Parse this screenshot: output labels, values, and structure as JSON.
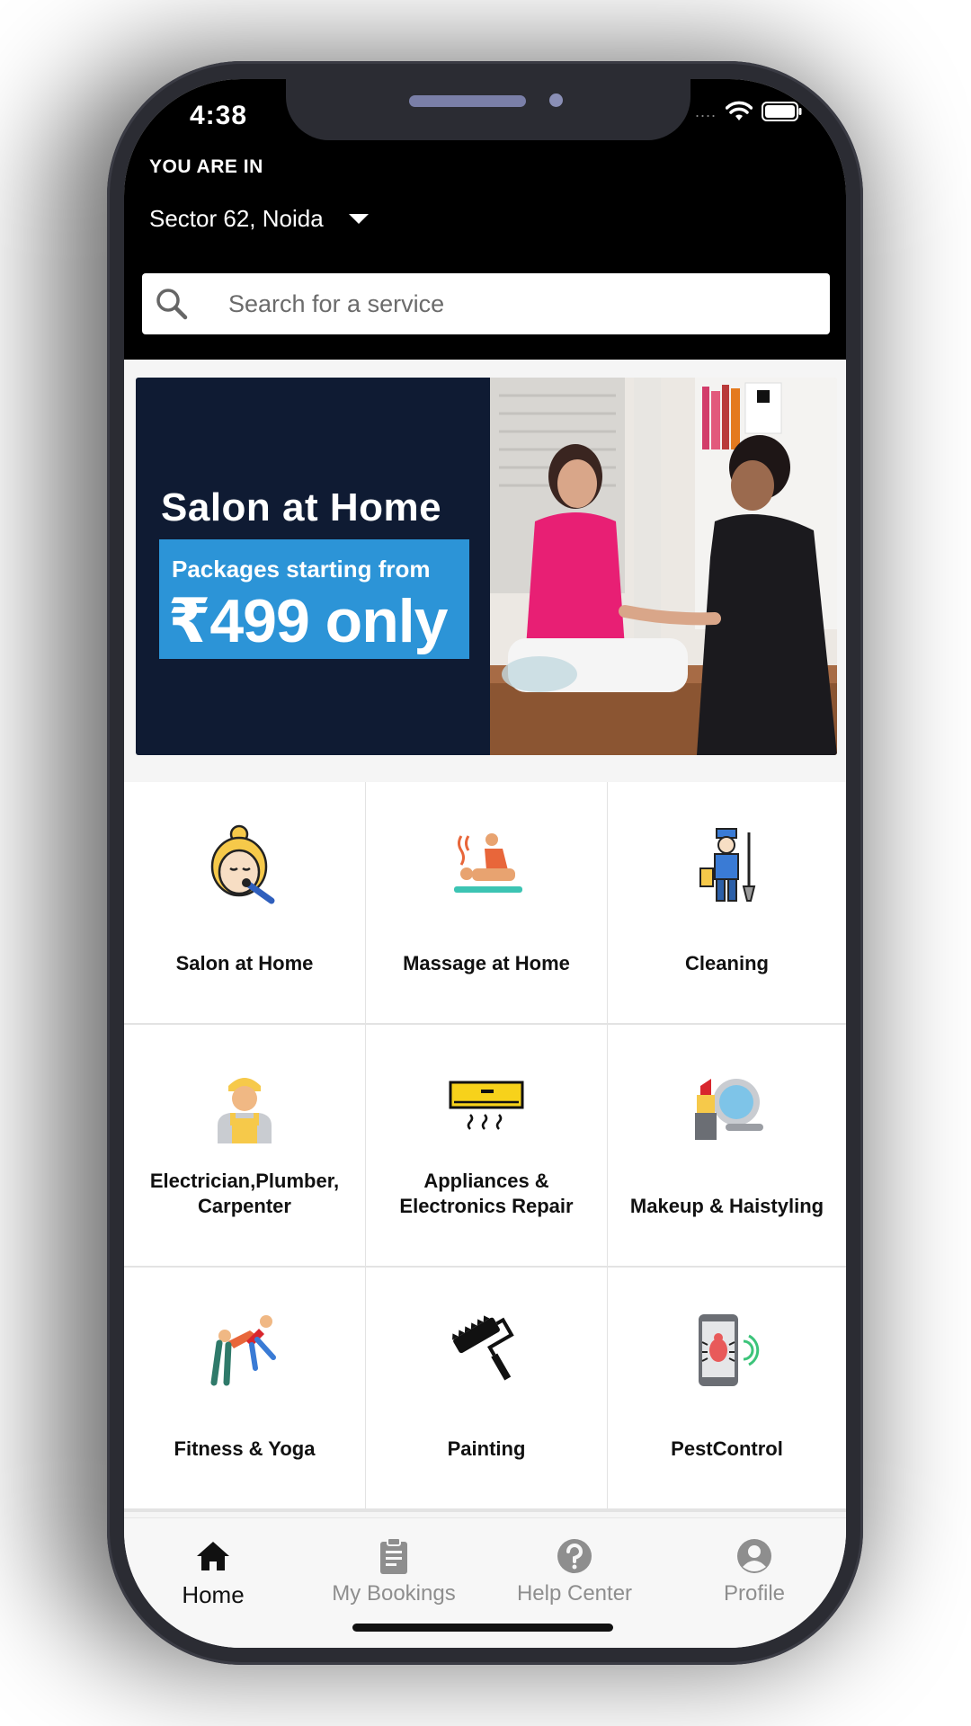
{
  "status_bar": {
    "time": "4:38",
    "signal": "....",
    "icons": [
      "wifi-icon",
      "battery-icon"
    ]
  },
  "location": {
    "caption": "YOU ARE IN",
    "value": "Sector 62, Noida"
  },
  "search": {
    "placeholder": "Search for a service"
  },
  "banner": {
    "title": "Salon at Home",
    "subtitle": "Packages starting from",
    "price": "₹499 only",
    "colors": {
      "left_bg": "#0f1b33",
      "badge_bg": "#2c94d7"
    }
  },
  "services": [
    {
      "label": "Salon at Home",
      "icon": "facial-icon"
    },
    {
      "label": "Massage at Home",
      "icon": "massage-icon"
    },
    {
      "label": "Cleaning",
      "icon": "cleaner-icon"
    },
    {
      "label": "Electrician,Plumber, Carpenter",
      "icon": "electrician-icon"
    },
    {
      "label": "Appliances & Electronics Repair",
      "icon": "air-conditioner-icon"
    },
    {
      "label": "Makeup & Haistyling",
      "icon": "makeup-icon"
    },
    {
      "label": "Fitness & Yoga",
      "icon": "yoga-icon"
    },
    {
      "label": "Painting",
      "icon": "paint-roller-icon"
    },
    {
      "label": "PestControl",
      "icon": "pest-control-icon"
    }
  ],
  "tabbar": {
    "items": [
      {
        "label": "Home",
        "icon": "home-icon",
        "active": true
      },
      {
        "label": "My Bookings",
        "icon": "clipboard-icon",
        "active": false
      },
      {
        "label": "Help Center",
        "icon": "help-icon",
        "active": false
      },
      {
        "label": "Profile",
        "icon": "profile-icon",
        "active": false
      }
    ]
  }
}
